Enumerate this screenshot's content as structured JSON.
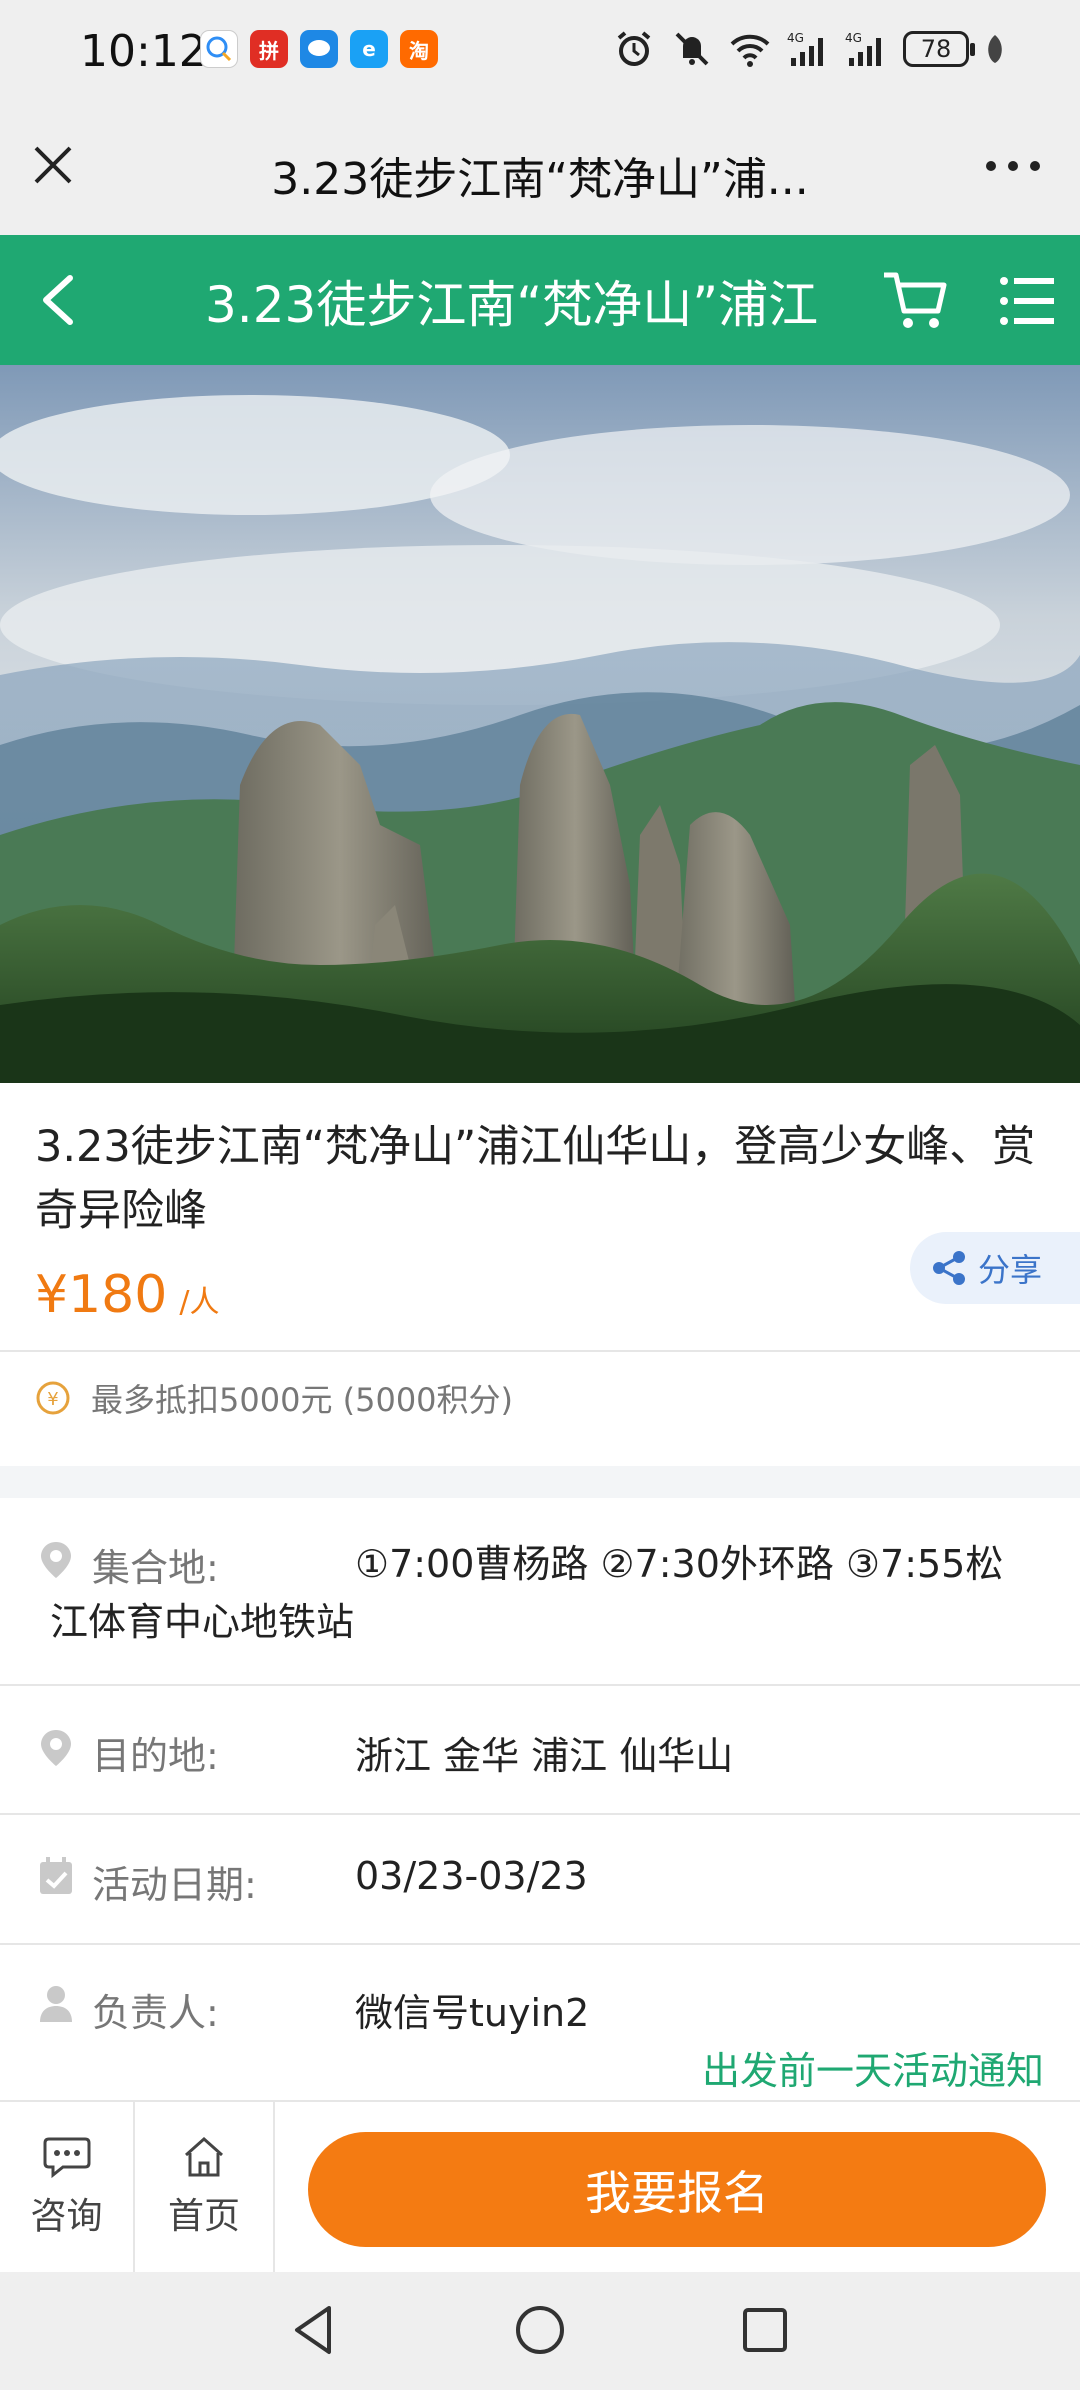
{
  "status_bar": {
    "time": "10:12",
    "battery": "78",
    "apps": [
      {
        "name": "qq-browser-icon",
        "color": "#ffffff"
      },
      {
        "name": "pinduoduo-icon",
        "color": "#e02e24"
      },
      {
        "name": "message-icon",
        "color": "#1e88e5"
      },
      {
        "name": "ele-icon",
        "color": "#1aa1f5"
      },
      {
        "name": "taobao-icon",
        "color": "#ff6a00"
      }
    ]
  },
  "browser": {
    "title": "3.23徒步江南“梵净山”浦..."
  },
  "header": {
    "title": "3.23徒步江南“梵净山”浦江",
    "color": "#1fa872"
  },
  "product": {
    "title": "3.23徒步江南“梵净山”浦江仙华山，登高少女峰、赏奇异险峰",
    "price": "¥180",
    "price_unit": "/人",
    "share_label": "分享",
    "points_text": "最多抵扣5000元 (5000积分)"
  },
  "info": {
    "meeting_label": "集合地:",
    "meeting_value": "①7:00曹杨路 ②7:30外环路 ③7:55松江体育中心地铁站",
    "destination_label": "目的地:",
    "destination_value": "浙江 金华 浦江 仙华山",
    "date_label": "活动日期:",
    "date_value": "03/23-03/23",
    "leader_label": "负责人:",
    "leader_value": "微信号tuyin2",
    "notice": "出发前一天活动通知"
  },
  "actions": {
    "consult_label": "咨询",
    "home_label": "首页",
    "signup_label": "我要报名",
    "signup_color": "#f47b12"
  }
}
